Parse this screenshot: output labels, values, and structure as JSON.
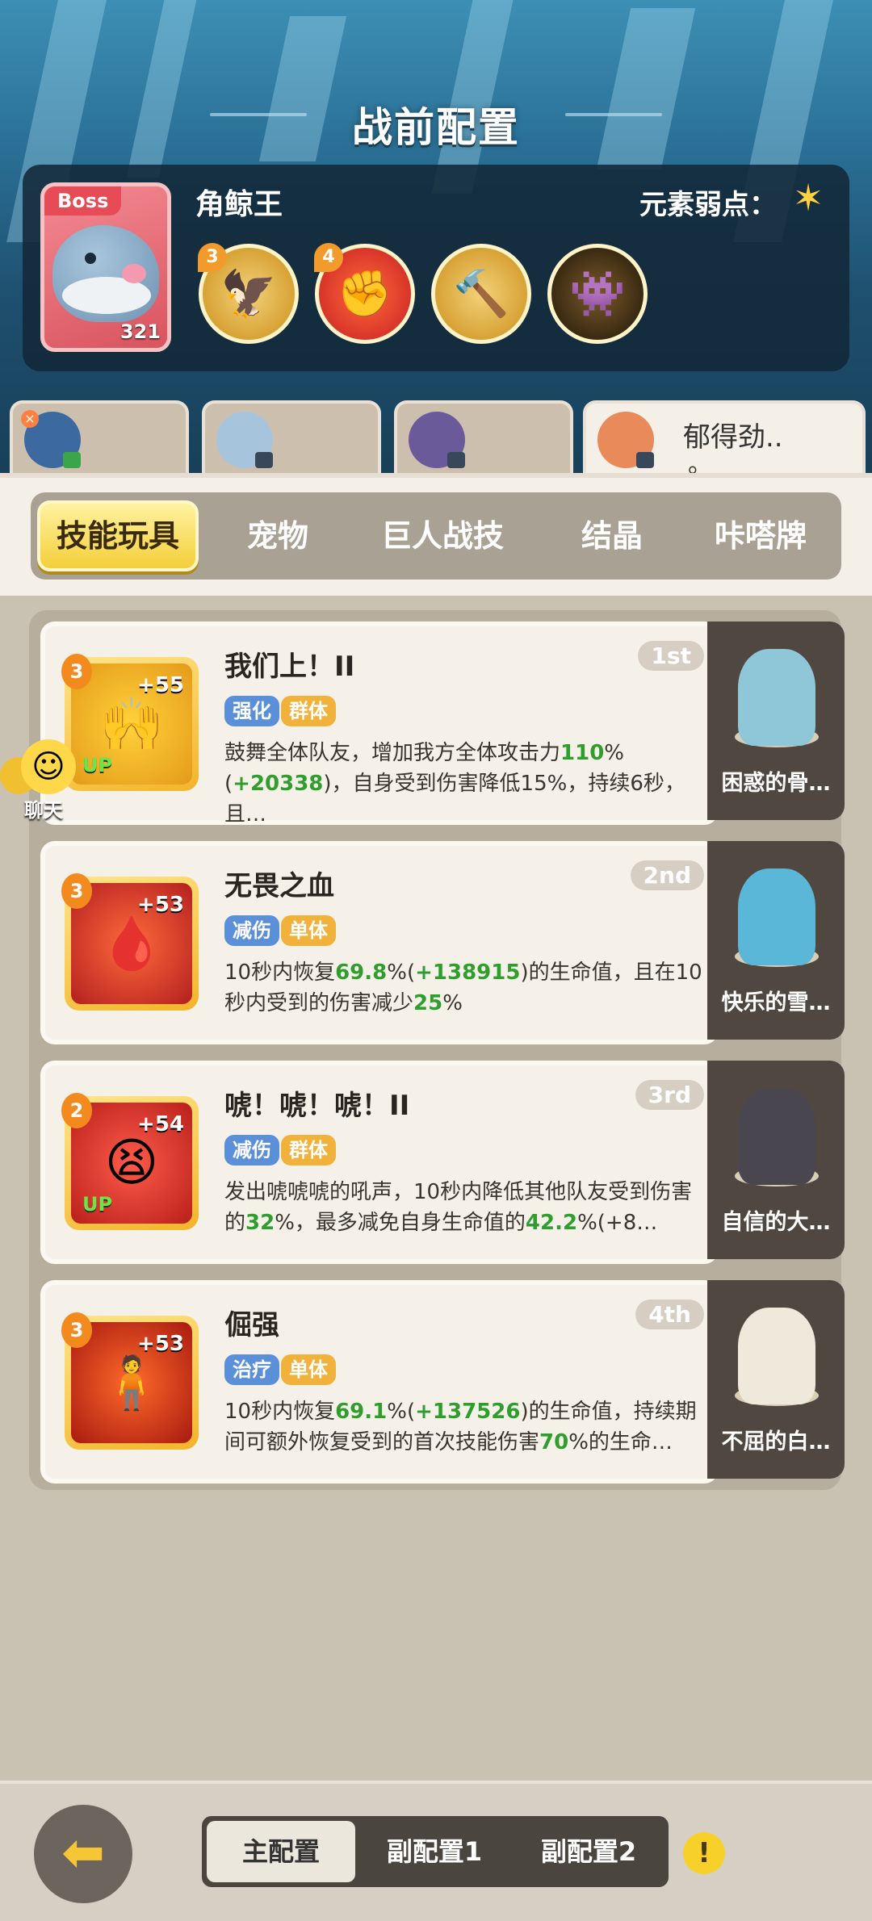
{
  "header": {
    "title": "战前配置"
  },
  "boss": {
    "tag": "Boss",
    "name": "角鲸王",
    "level": "321",
    "weakness_label": "元素弱点：",
    "weakness_icon": "star-icon",
    "skills": [
      {
        "level": "3",
        "icon": "flying-bird-icon"
      },
      {
        "level": "4",
        "icon": "fist-icon"
      },
      {
        "level": "",
        "icon": "hammer-icon"
      },
      {
        "level": "",
        "icon": "shadow-monster-icon"
      }
    ]
  },
  "teammates": [
    {
      "name": "",
      "sub": ""
    },
    {
      "name": "",
      "sub": ""
    },
    {
      "name": "",
      "sub": ""
    },
    {
      "name": "郁得劲..",
      "sub": "。"
    }
  ],
  "tabs": [
    "技能玩具",
    "宠物",
    "巨人战技",
    "结晶",
    "咔嗒牌"
  ],
  "skills": [
    {
      "level": "3",
      "plus": "+55",
      "up": "UP",
      "name": "我们上！II",
      "rank": "1st",
      "tags": [
        "强化",
        "群体"
      ],
      "desc_pre": "鼓舞全体队友，增加我方全体攻击力",
      "v1": "110",
      "mid1": "%(",
      "v2": "+20338",
      "desc_post": ")，自身受到伤害降低15%，持续6秒，且…",
      "pet": "困惑的骨…"
    },
    {
      "level": "3",
      "plus": "+53",
      "up": "",
      "name": "无畏之血",
      "rank": "2nd",
      "tags": [
        "减伤",
        "单体"
      ],
      "desc_pre": "10秒内恢复",
      "v1": "69.8",
      "mid1": "%(",
      "v2": "+138915",
      "desc_post": ")的生命值，且在10秒内受到的伤害减少",
      "v3": "25",
      "desc_end": "%",
      "pet": "快乐的雪…"
    },
    {
      "level": "2",
      "plus": "+54",
      "up": "UP",
      "name": "唬！唬！唬！II",
      "rank": "3rd",
      "tags": [
        "减伤",
        "群体"
      ],
      "desc_pre": "发出唬唬唬的吼声，10秒内降低其他队友受到伤害的",
      "v1": "32",
      "mid1": "%，最多减免自身生命值的",
      "v2": "42.2",
      "desc_post": "%(+8…",
      "pet": "自信的大…"
    },
    {
      "level": "3",
      "plus": "+53",
      "up": "",
      "name": "倔强",
      "rank": "4th",
      "tags": [
        "治疗",
        "单体"
      ],
      "desc_pre": "10秒内恢复",
      "v1": "69.1",
      "mid1": "%(",
      "v2": "+137526",
      "desc_post": ")的生命值，持续期间可额外恢复受到的首次技能伤害",
      "v3": "70",
      "desc_end": "%的生命…",
      "pet": "不屈的白…"
    }
  ],
  "chat": {
    "label": "聊天"
  },
  "configs": [
    "主配置",
    "副配置1",
    "副配置2"
  ],
  "alert": "!"
}
